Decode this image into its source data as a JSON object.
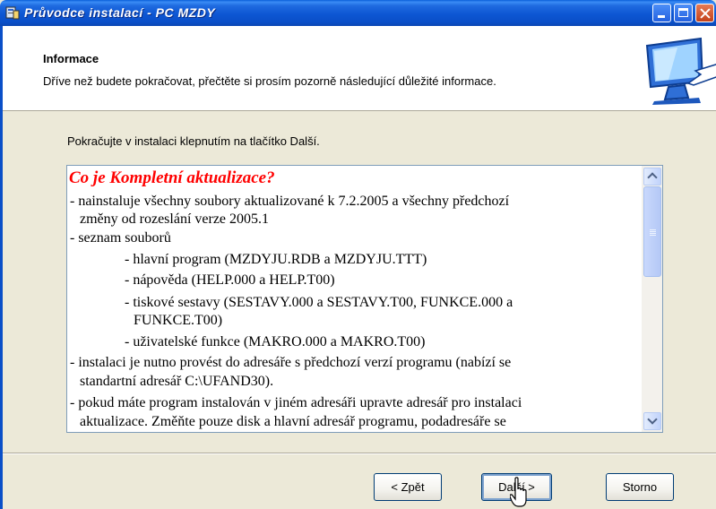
{
  "window": {
    "title": "Průvodce instalací - PC MZDY",
    "controls": [
      "minimize",
      "maximize",
      "close"
    ]
  },
  "header": {
    "title": "Informace",
    "subtitle": "Dříve než budete pokračovat, přečtěte si prosím pozorně následující důležité informace.",
    "icon": "setup-computer-icon"
  },
  "instruction": "Pokračujte v instalaci klepnutím na tlačítko Další.",
  "memo": {
    "heading": "Co je Kompletní aktualizace?",
    "lines": [
      "- nainstaluje všechny soubory aktualizované k 7.2.2005 a všechny předchozí",
      "změny od rozeslání verze 2005.1",
      "- seznam souborů",
      "- hlavní program (MZDYJU.RDB a MZDYJU.TTT)",
      "- nápověda (HELP.000 a HELP.T00)",
      "- tiskové sestavy (SESTAVY.000 a SESTAVY.T00, FUNKCE.000 a",
      "FUNKCE.T00)",
      "- uživatelské funkce (MAKRO.000 a MAKRO.T00)",
      "- instalaci je nutno provést do adresáře s předchozí verzí programu (nabízí se",
      "standartní adresář C:\\UFAND30).",
      "- pokud máte program instalován v jiném adresáři upravte adresář pro instalaci",
      "aktualizace. Změňte pouze disk a hlavní adresář programu, podadresáře se"
    ]
  },
  "buttons": {
    "back": "< Zpět",
    "next": "Další >",
    "cancel": "Storno"
  },
  "colors": {
    "title_bar": "#0a4fc8",
    "heading_red": "#ff0000",
    "dialog_bg": "#ece9d8"
  }
}
